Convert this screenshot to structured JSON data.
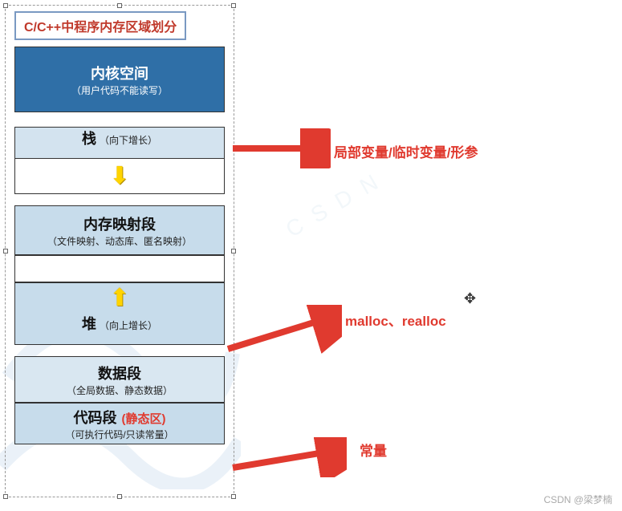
{
  "title": "C/C++中程序内存区域划分",
  "segments": {
    "kernel": {
      "title": "内核空间",
      "sub": "（用户代码不能读写）"
    },
    "stack": {
      "title": "栈",
      "sub": "（向下增长）"
    },
    "mmap": {
      "title": "内存映射段",
      "sub": "（文件映射、动态库、匿名映射）"
    },
    "heap": {
      "title": "堆",
      "sub": "（向上增长）"
    },
    "data": {
      "title": "数据段",
      "sub": "（全局数据、静态数据）"
    },
    "code": {
      "title": "代码段",
      "static_tag": "(静态区)",
      "sub": "（可执行代码/只读常量）"
    }
  },
  "annotations": {
    "stack_note": "局部变量/临时变量/形参",
    "heap_note": "malloc、realloc",
    "code_note": "常量"
  },
  "footer": {
    "site": "CSDN",
    "author": "@梁梦楠"
  },
  "icons": {
    "arrow_down": "⬇",
    "arrow_up": "⬆"
  }
}
